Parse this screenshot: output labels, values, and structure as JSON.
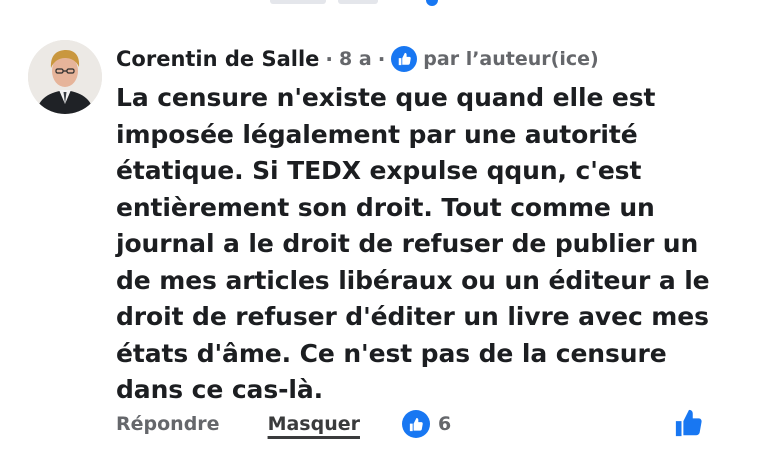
{
  "comment": {
    "author": "Corentin de Salle",
    "time": "8 a",
    "author_badge": "par l’auteur(ice)",
    "text": "La censure n'existe que quand elle est imposée légalement par une autorité étatique. Si TEDX expulse qqun, c'est entièrement son droit. Tout comme un journal a le droit de refuser de publier un de mes articles libéraux ou un éditeur a le droit de refuser d'éditer un livre avec mes états d'âme. Ce n'est pas de la censure dans ce cas-là."
  },
  "actions": {
    "reply_label": "Répondre",
    "hide_label": "Masquer",
    "reaction_count": "6"
  },
  "icons": {
    "like_badge": "thumbs-up-icon",
    "like_action": "thumbs-up-icon"
  },
  "colors": {
    "accent": "#1877f2",
    "text": "#1c1e21",
    "muted": "#65676b"
  }
}
